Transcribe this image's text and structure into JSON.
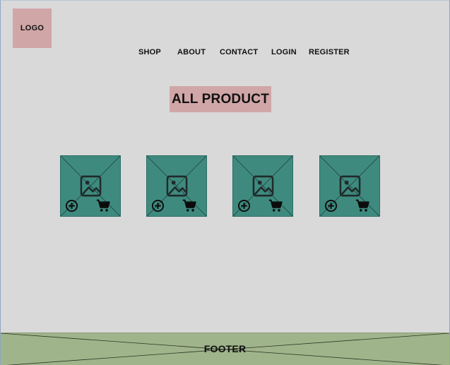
{
  "logo": {
    "label": "LOGO"
  },
  "nav": {
    "items": [
      {
        "label": "SHOP"
      },
      {
        "label": "ABOUT"
      },
      {
        "label": "CONTACT"
      },
      {
        "label": "LOGIN"
      },
      {
        "label": "REGISTER"
      }
    ]
  },
  "main": {
    "title": "ALL PRODUCT",
    "products": [
      {
        "image": "image-placeholder-icon",
        "actions": [
          "add-circle-icon",
          "cart-icon"
        ]
      },
      {
        "image": "image-placeholder-icon",
        "actions": [
          "add-circle-icon",
          "cart-icon"
        ]
      },
      {
        "image": "image-placeholder-icon",
        "actions": [
          "add-circle-icon",
          "cart-icon"
        ]
      },
      {
        "image": "image-placeholder-icon",
        "actions": [
          "add-circle-icon",
          "cart-icon"
        ]
      }
    ]
  },
  "footer": {
    "label": "FOOTER"
  },
  "colors": {
    "background": "#d9d9d9",
    "logo_bg": "#d1a6a7",
    "title_bg": "#d1a6a7",
    "card_bg": "#3f8a7f",
    "footer_bg": "#a0b48b"
  }
}
